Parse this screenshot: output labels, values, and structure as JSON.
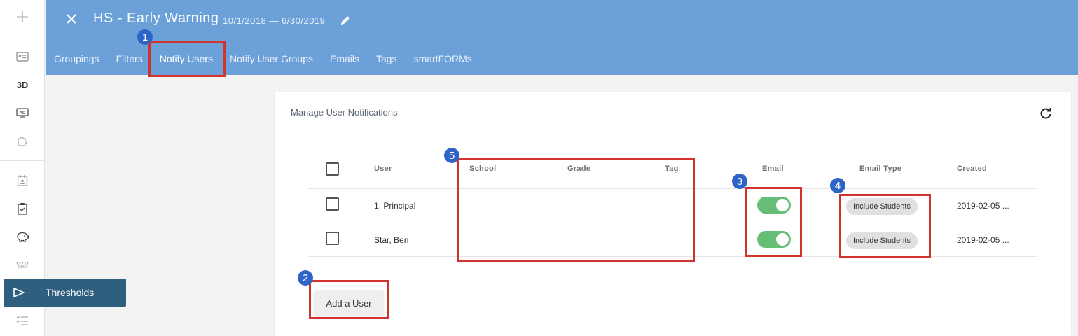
{
  "rail": {
    "plus": "+",
    "label_3d": "3D",
    "active_item": "Thresholds"
  },
  "header": {
    "title": "HS - Early Warning",
    "date_range": "10/1/2018 — 6/30/2019",
    "tabs": [
      "Groupings",
      "Filters",
      "Notify Users",
      "Notify User Groups",
      "Emails",
      "Tags",
      "smartFORMs"
    ],
    "active_tab": "Notify Users"
  },
  "card": {
    "title": "Manage User Notifications",
    "columns": {
      "user": "User",
      "school": "School",
      "grade": "Grade",
      "tag": "Tag",
      "email": "Email",
      "email_type": "Email Type",
      "created": "Created"
    },
    "rows": [
      {
        "user": "1, Principal",
        "school": "",
        "grade": "",
        "tag": "",
        "email_on": true,
        "email_type": "Include Students",
        "created": "2019-02-05 ..."
      },
      {
        "user": "Star, Ben",
        "school": "",
        "grade": "",
        "tag": "",
        "email_on": true,
        "email_type": "Include Students",
        "created": "2019-02-05 ..."
      }
    ],
    "add_button": "Add a User"
  },
  "annotations": [
    "1",
    "2",
    "3",
    "4",
    "5"
  ],
  "colors": {
    "header_bg": "#6ca0d8",
    "active_rail": "#2f5f7f",
    "toggle_on": "#65bd76",
    "highlight": "#d0342c",
    "badge": "#2d64c8"
  }
}
